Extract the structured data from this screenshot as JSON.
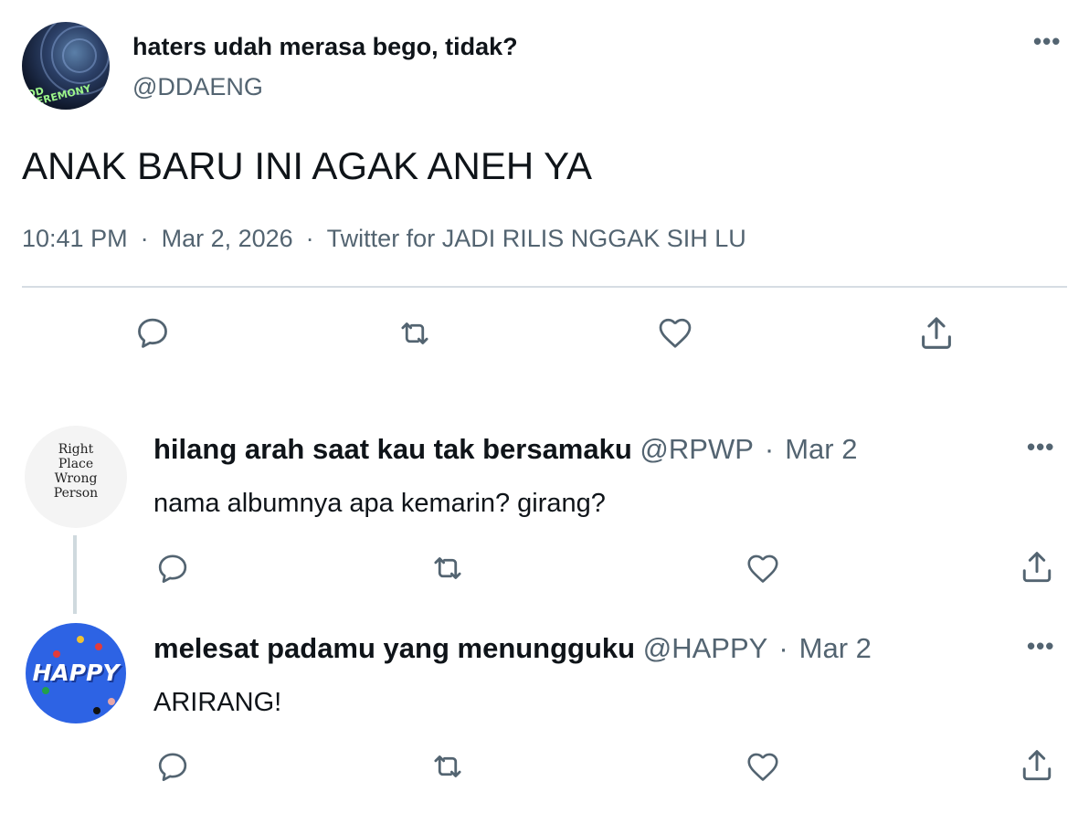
{
  "tweet": {
    "display_name": "haters udah merasa bego, tidak?",
    "handle": "@DDAENG",
    "avatar_text": "DD CEREMONY",
    "text": "ANAK BARU INI AGAK ANEH YA",
    "time": "10:41 PM",
    "date": "Mar 2, 2026",
    "source": "Twitter for JADI RILIS NGGAK SIH LU",
    "separator": "·",
    "more": "•••"
  },
  "actions": {
    "reply_icon": "reply-icon",
    "retweet_icon": "retweet-icon",
    "like_icon": "heart-icon",
    "share_icon": "share-icon"
  },
  "replies": [
    {
      "display_name": "hilang arah saat kau tak bersamaku",
      "handle": "@RPWP",
      "date": "Mar 2",
      "text": "nama albumnya apa kemarin? girang?",
      "avatar_text": "Right Place Wrong Person",
      "more": "•••"
    },
    {
      "display_name": "melesat padamu yang menungguku",
      "handle": "@HAPPY",
      "date": "Mar 2",
      "text": "ARIRANG!",
      "avatar_text": "HAPPY",
      "more": "•••"
    }
  ],
  "colors": {
    "text": "#0f1419",
    "secondary": "#536471",
    "divider": "#d6dde3",
    "happy_blue": "#2d63e4"
  }
}
